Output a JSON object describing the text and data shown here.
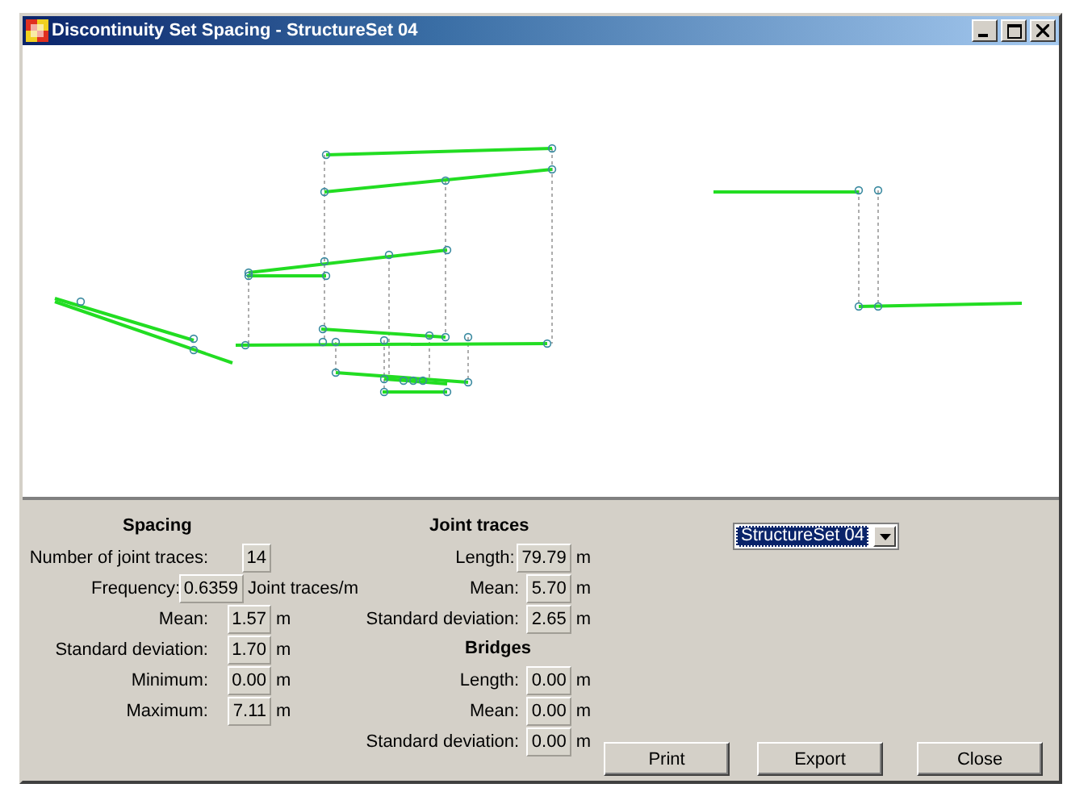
{
  "window": {
    "title": "Discontinuity Set Spacing - StructureSet 04"
  },
  "spacing": {
    "heading": "Spacing",
    "rows": [
      {
        "label": "Number of joint traces:",
        "value": "14"
      },
      {
        "label": "Frequency:",
        "value": "0.6359",
        "unit": "Joint traces/m"
      },
      {
        "label": "Mean:",
        "value": "1.57",
        "unit": "m"
      },
      {
        "label": "Standard deviation:",
        "value": "1.70",
        "unit": "m"
      },
      {
        "label": "Minimum:",
        "value": "0.00",
        "unit": "m"
      },
      {
        "label": "Maximum:",
        "value": "7.11",
        "unit": "m"
      }
    ]
  },
  "joint_traces": {
    "heading": "Joint traces",
    "rows": [
      {
        "label": "Length:",
        "value": "79.79",
        "unit": "m"
      },
      {
        "label": "Mean:",
        "value": "5.70",
        "unit": "m"
      },
      {
        "label": "Standard deviation:",
        "value": "2.65",
        "unit": "m"
      }
    ]
  },
  "bridges": {
    "heading": "Bridges",
    "rows": [
      {
        "label": "Length:",
        "value": "0.00",
        "unit": "m"
      },
      {
        "label": "Mean:",
        "value": "0.00",
        "unit": "m"
      },
      {
        "label": "Standard deviation:",
        "value": "0.00",
        "unit": "m"
      }
    ]
  },
  "structure_set_dropdown": {
    "value": "StructureSet 04"
  },
  "buttons": [
    "Print",
    "Export",
    "Close"
  ]
}
